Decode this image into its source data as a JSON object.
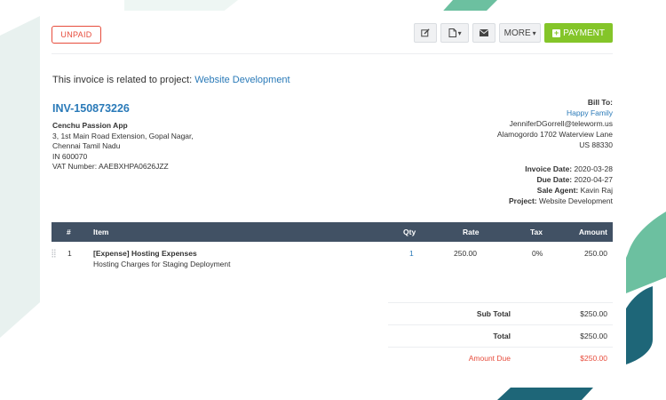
{
  "colors": {
    "status_red": "#e74c3c",
    "link_blue": "#2a7ab8",
    "payment_green": "#84c529",
    "table_header_bg": "#415164"
  },
  "invoice": {
    "status": "UNPAID",
    "related_prefix": "This invoice is related to project:",
    "related_project": "Website Development",
    "number": "INV-150873226"
  },
  "toolbar": {
    "edit_icon": "pencil-square-icon",
    "pdf_icon": "file-pdf-icon",
    "pdf_caret": "▾",
    "email_icon": "envelope-icon",
    "more_label": "MORE",
    "more_caret": "▾",
    "payment_icon": "plus-square-icon",
    "payment_label": "PAYMENT"
  },
  "company": {
    "name": "Cenchu Passion App",
    "address_line1": "3, 1st Main Road Extension, Gopal Nagar,",
    "address_line2": "Chennai Tamil Nadu",
    "address_line3": "IN 600070",
    "vat": "VAT Number: AAEBXHPA0626JZZ"
  },
  "bill_to": {
    "heading": "Bill To:",
    "client": "Happy Family",
    "email": "JenniferDGorrell@teleworm.us",
    "address": "Alamogordo 1702 Waterview Lane",
    "region": "US 88330"
  },
  "meta": {
    "invoice_date_label": "Invoice Date:",
    "invoice_date": "2020-03-28",
    "due_date_label": "Due Date:",
    "due_date": "2020-04-27",
    "sale_agent_label": "Sale Agent:",
    "sale_agent": "Kavin Raj",
    "project_label": "Project:",
    "project": "Website Development"
  },
  "table": {
    "headers": [
      "#",
      "Item",
      "Qty",
      "Rate",
      "Tax",
      "Amount"
    ],
    "rows": [
      {
        "num": "1",
        "item": "[Expense] Hosting Expenses",
        "description": "Hosting Charges for Staging Deployment",
        "qty": "1",
        "rate": "250.00",
        "tax": "0%",
        "amount": "250.00"
      }
    ]
  },
  "totals": {
    "subtotal_label": "Sub Total",
    "subtotal": "$250.00",
    "total_label": "Total",
    "total": "$250.00",
    "amount_due_label": "Amount Due",
    "amount_due": "$250.00"
  }
}
